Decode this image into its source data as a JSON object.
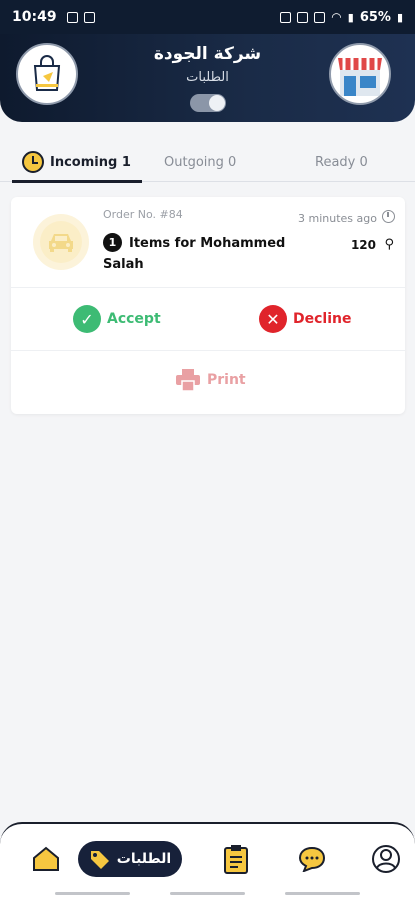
{
  "status_bar": {
    "time": "10:49",
    "battery": "65%"
  },
  "header": {
    "company_name": "شركة الجودة",
    "subtitle": "الطلبات",
    "toggle_on": true
  },
  "tabs": [
    {
      "label": "Incoming 1",
      "active": true
    },
    {
      "label": "Outgoing 0",
      "active": false
    },
    {
      "label": "Ready 0",
      "active": false
    }
  ],
  "order": {
    "number": "Order No. #84",
    "time_ago": "3 minutes ago",
    "item_count": "1",
    "items_text": "Items for Mohammed Salah",
    "price": "120",
    "accept_label": "Accept",
    "decline_label": "Decline",
    "print_label": "Print"
  },
  "bottom_nav": {
    "orders_label": "الطلبات"
  },
  "colors": {
    "accent": "#17213a",
    "accept": "#3dbb74",
    "decline": "#e0242b",
    "print": "#e9a0a3",
    "highlight": "#f6c740"
  }
}
